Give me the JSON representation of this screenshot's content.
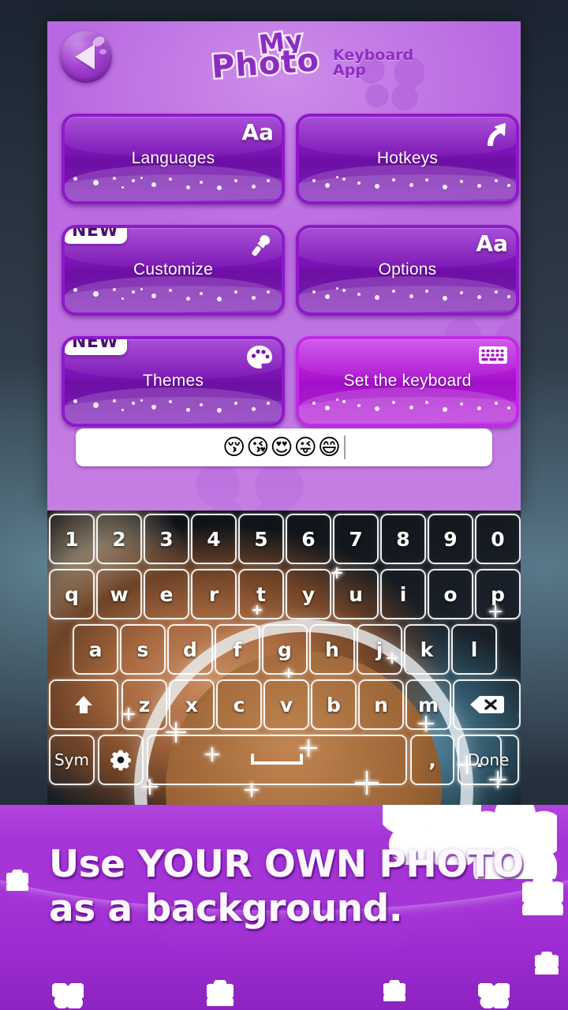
{
  "header": {
    "back_icon": "back-arrow-icon",
    "logo_line1": "My",
    "logo_line2": "Photo",
    "logo_sub1": "Keyboard",
    "logo_sub2": "App"
  },
  "menu": {
    "badge_new": "NEW",
    "tiles": [
      {
        "label": "Languages",
        "icon": "text-size-icon",
        "icon_text": "Aa",
        "badge": null,
        "style": "dark"
      },
      {
        "label": "Hotkeys",
        "icon": "shortcut-arrow-icon",
        "icon_text": "",
        "badge": null,
        "style": "dark"
      },
      {
        "label": "Customize",
        "icon": "brush-icon",
        "icon_text": "",
        "badge": "NEW",
        "style": "dark"
      },
      {
        "label": "Options",
        "icon": "text-size-icon",
        "icon_text": "Aa",
        "badge": null,
        "style": "dark"
      },
      {
        "label": "Themes",
        "icon": "palette-icon",
        "icon_text": "",
        "badge": "NEW",
        "style": "dark"
      },
      {
        "label": "Set the keyboard",
        "icon": "keyboard-icon",
        "icon_text": "",
        "badge": null,
        "style": "bright"
      }
    ]
  },
  "input": {
    "value": "😚😘😍😜😄",
    "placeholder": ""
  },
  "keyboard": {
    "row_numbers": [
      "1",
      "2",
      "3",
      "4",
      "5",
      "6",
      "7",
      "8",
      "9",
      "0"
    ],
    "row_top": [
      "q",
      "w",
      "e",
      "r",
      "t",
      "y",
      "u",
      "i",
      "o",
      "p"
    ],
    "row_home": [
      "a",
      "s",
      "d",
      "f",
      "g",
      "h",
      "j",
      "k",
      "l"
    ],
    "row_bottom": [
      "z",
      "x",
      "c",
      "v",
      "b",
      "n",
      "m"
    ],
    "shift_icon": "shift-up-icon",
    "backspace_icon": "backspace-icon",
    "sym_label": "Sym",
    "settings_icon": "gear-icon",
    "space_label": "",
    "comma_label": ",",
    "period_label": ".",
    "done_label": "Done"
  },
  "banner": {
    "line1": "Use YOUR OWN PHOTO",
    "line2": "as a background."
  },
  "colors": {
    "panel_purple": "#bb6ae0",
    "tile_purple": "#7a12b4",
    "tile_border": "#8f18cb",
    "tile_bright": "#ad16d2",
    "banner_purple": "#a635d8",
    "logo_purple": "#8d2cc2",
    "key_white": "#ffffff"
  }
}
